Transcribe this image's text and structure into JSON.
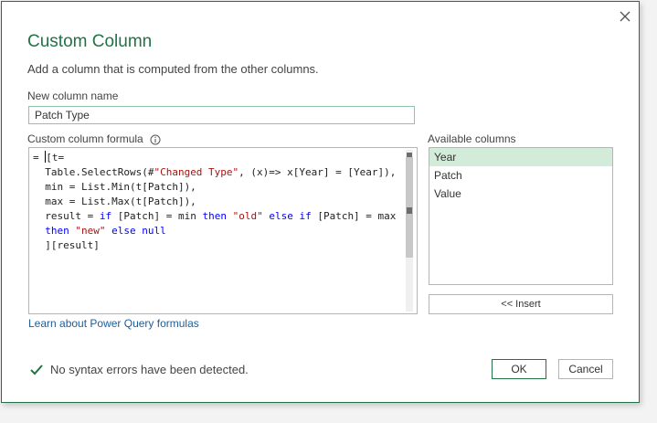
{
  "dialog": {
    "title": "Custom Column",
    "subtitle": "Add a column that is computed from the other columns.",
    "close_icon": "close-icon"
  },
  "column_name": {
    "label": "New column name",
    "value": "Patch Type"
  },
  "formula": {
    "label": "Custom column formula",
    "info_icon": "info-icon"
  },
  "available_columns": {
    "label": "Available columns",
    "items": [
      "Year",
      "Patch",
      "Value"
    ],
    "selected": "Year",
    "insert_label": "<< Insert"
  },
  "learn_link": "Learn about Power Query formulas",
  "status": {
    "icon": "checkmark-icon",
    "text": "No syntax errors have been detected."
  },
  "buttons": {
    "ok": "OK",
    "cancel": "Cancel"
  },
  "colors": {
    "accent": "#217346",
    "keyword": "#0000ff",
    "string": "#a31515",
    "link": "#1f5c99",
    "selected_row": "#d3ecd9"
  }
}
